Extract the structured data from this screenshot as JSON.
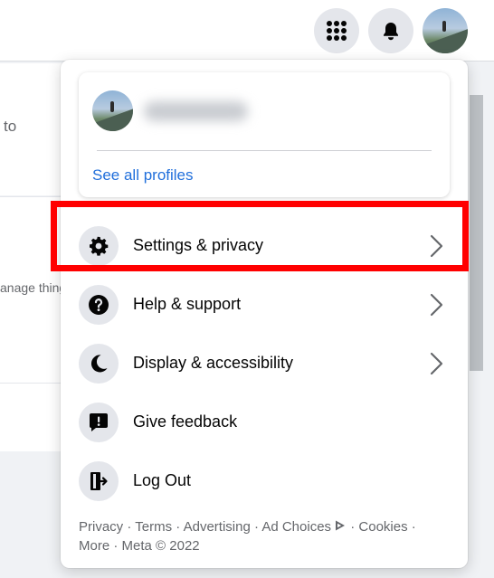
{
  "background": {
    "card1_text": "to",
    "card2_text": "anage thing"
  },
  "topbar": {
    "menu_icon": "grid-icon",
    "notifications_icon": "bell-icon",
    "profile_icon": "avatar"
  },
  "profile_card": {
    "see_all_label": "See all profiles"
  },
  "menu_items": [
    {
      "label": "Settings & privacy",
      "icon": "gear-icon",
      "has_chevron": true
    },
    {
      "label": "Help & support",
      "icon": "question-icon",
      "has_chevron": true
    },
    {
      "label": "Display & accessibility",
      "icon": "moon-icon",
      "has_chevron": true
    },
    {
      "label": "Give feedback",
      "icon": "feedback-icon",
      "has_chevron": false
    },
    {
      "label": "Log Out",
      "icon": "logout-icon",
      "has_chevron": false
    }
  ],
  "footer": {
    "privacy": "Privacy",
    "terms": "Terms",
    "advertising": "Advertising",
    "ad_choices": "Ad Choices",
    "cookies": "Cookies",
    "more": "More",
    "meta": "Meta © 2022",
    "separator": " · "
  },
  "colors": {
    "accent_link": "#216fdb",
    "highlight_border": "#ff0000",
    "icon_circle_bg": "#e4e6eb"
  }
}
